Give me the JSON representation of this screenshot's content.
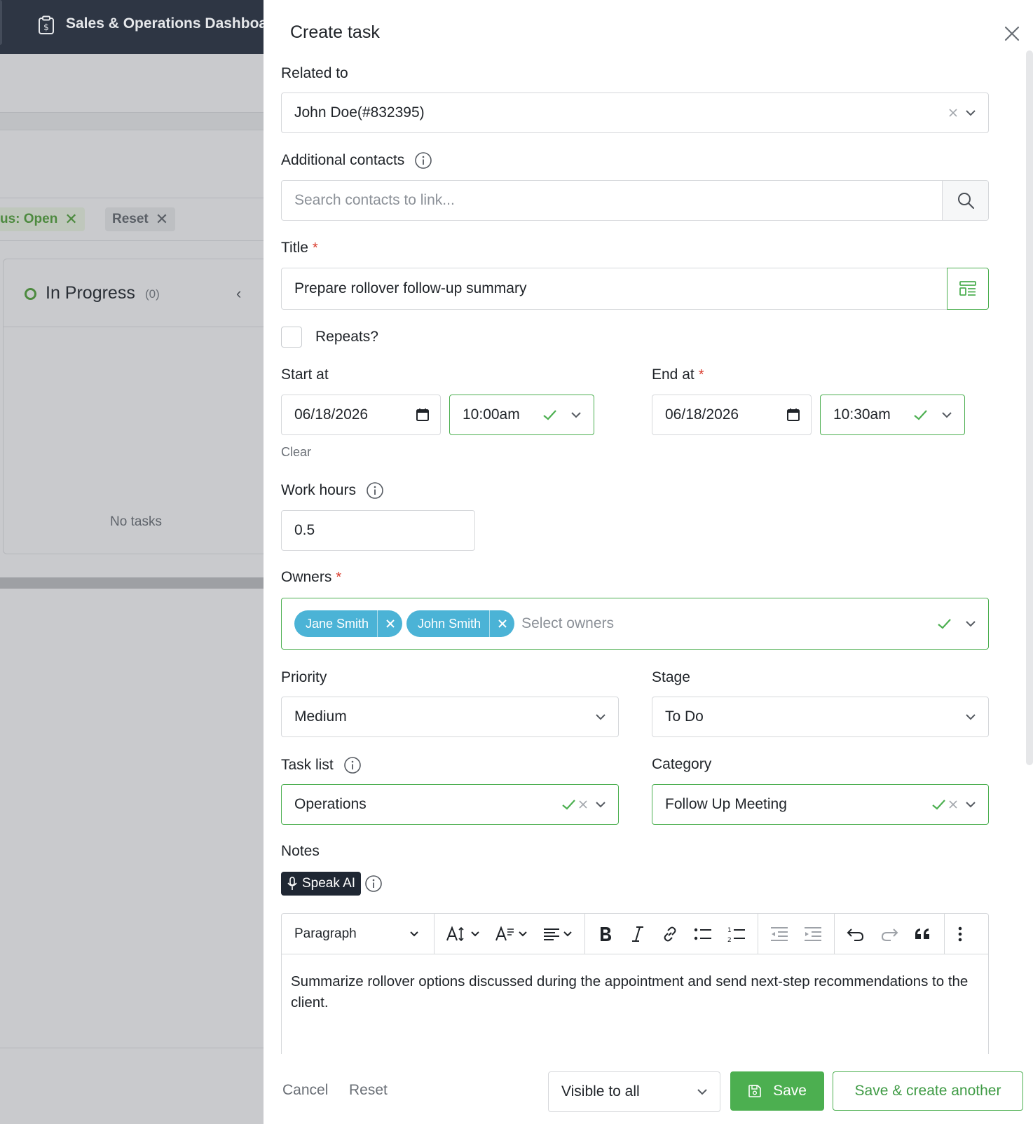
{
  "background": {
    "app_title": "Sales & Operations Dashboard",
    "filters": {
      "status_chip": "us: Open",
      "reset_chip": "Reset"
    },
    "column": {
      "title": "In Progress",
      "count": "(0)",
      "empty_text": "No tasks"
    }
  },
  "drawer": {
    "title": "Create task",
    "related_to": {
      "label": "Related to",
      "value": "John Doe(#832395)"
    },
    "additional_contacts": {
      "label": "Additional contacts",
      "placeholder": "Search contacts to link..."
    },
    "title_field": {
      "label": "Title",
      "required": "*",
      "value": "Prepare rollover follow-up summary"
    },
    "repeats": {
      "label": "Repeats?",
      "checked": false
    },
    "start_at": {
      "label": "Start at",
      "date": "06/18/2026",
      "time": "10:00am",
      "clear": "Clear"
    },
    "end_at": {
      "label": "End at",
      "required": "*",
      "date": "06/18/2026",
      "time": "10:30am"
    },
    "work_hours": {
      "label": "Work hours",
      "value": "0.5"
    },
    "owners": {
      "label": "Owners",
      "required": "*",
      "tags": [
        "Jane Smith",
        "John Smith"
      ],
      "placeholder": "Select owners"
    },
    "priority": {
      "label": "Priority",
      "value": "Medium"
    },
    "stage": {
      "label": "Stage",
      "value": "To Do"
    },
    "task_list": {
      "label": "Task list",
      "value": "Operations"
    },
    "category": {
      "label": "Category",
      "value": "Follow Up Meeting"
    },
    "notes": {
      "label": "Notes",
      "speak_ai": "Speak AI",
      "paragraph_style": "Paragraph",
      "body": "Summarize rollover options discussed during the appointment and send next-step recommendations to the client."
    },
    "footer": {
      "cancel": "Cancel",
      "reset": "Reset",
      "visibility": "Visible to all",
      "save": "Save",
      "save_another": "Save & create another"
    }
  },
  "colors": {
    "accent_green": "#4caf50",
    "tag_blue": "#4bb3d6",
    "required_red": "#d93a2b",
    "topbar": "#2e3644"
  }
}
